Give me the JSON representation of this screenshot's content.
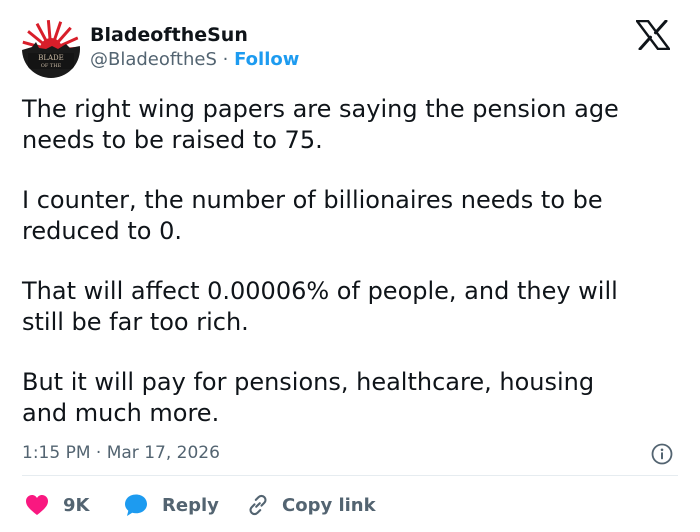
{
  "author": {
    "display_name": "BladeoftheSun",
    "handle": "@BladeoftheS",
    "separator": "·",
    "follow_label": "Follow",
    "avatar_text": [
      "BLADE",
      "OF THE"
    ]
  },
  "tweet": {
    "paragraphs": [
      [
        "The right wing papers are saying the pension age",
        "needs to be raised to 75."
      ],
      [
        "I counter, the number of billionaires needs to be",
        "reduced to 0."
      ],
      [
        "That will affect 0.00006% of people, and they will",
        "still be far too rich."
      ],
      [
        "But it will pay for pensions, healthcare, housing",
        "and much more."
      ]
    ],
    "timestamp": "1:15 PM · Mar 17, 2026"
  },
  "actions": {
    "like_count": "9K",
    "reply_label": "Reply",
    "copy_link_label": "Copy link"
  },
  "icons": {
    "brand": "x-logo-icon",
    "info": "info-icon",
    "like": "heart-icon",
    "reply": "speech-bubble-icon",
    "copy": "link-icon"
  },
  "colors": {
    "text": "#0f1419",
    "secondary": "#536471",
    "link": "#1d9bf0",
    "like": "#f91880",
    "avatar_sun": "#d81e2a"
  }
}
